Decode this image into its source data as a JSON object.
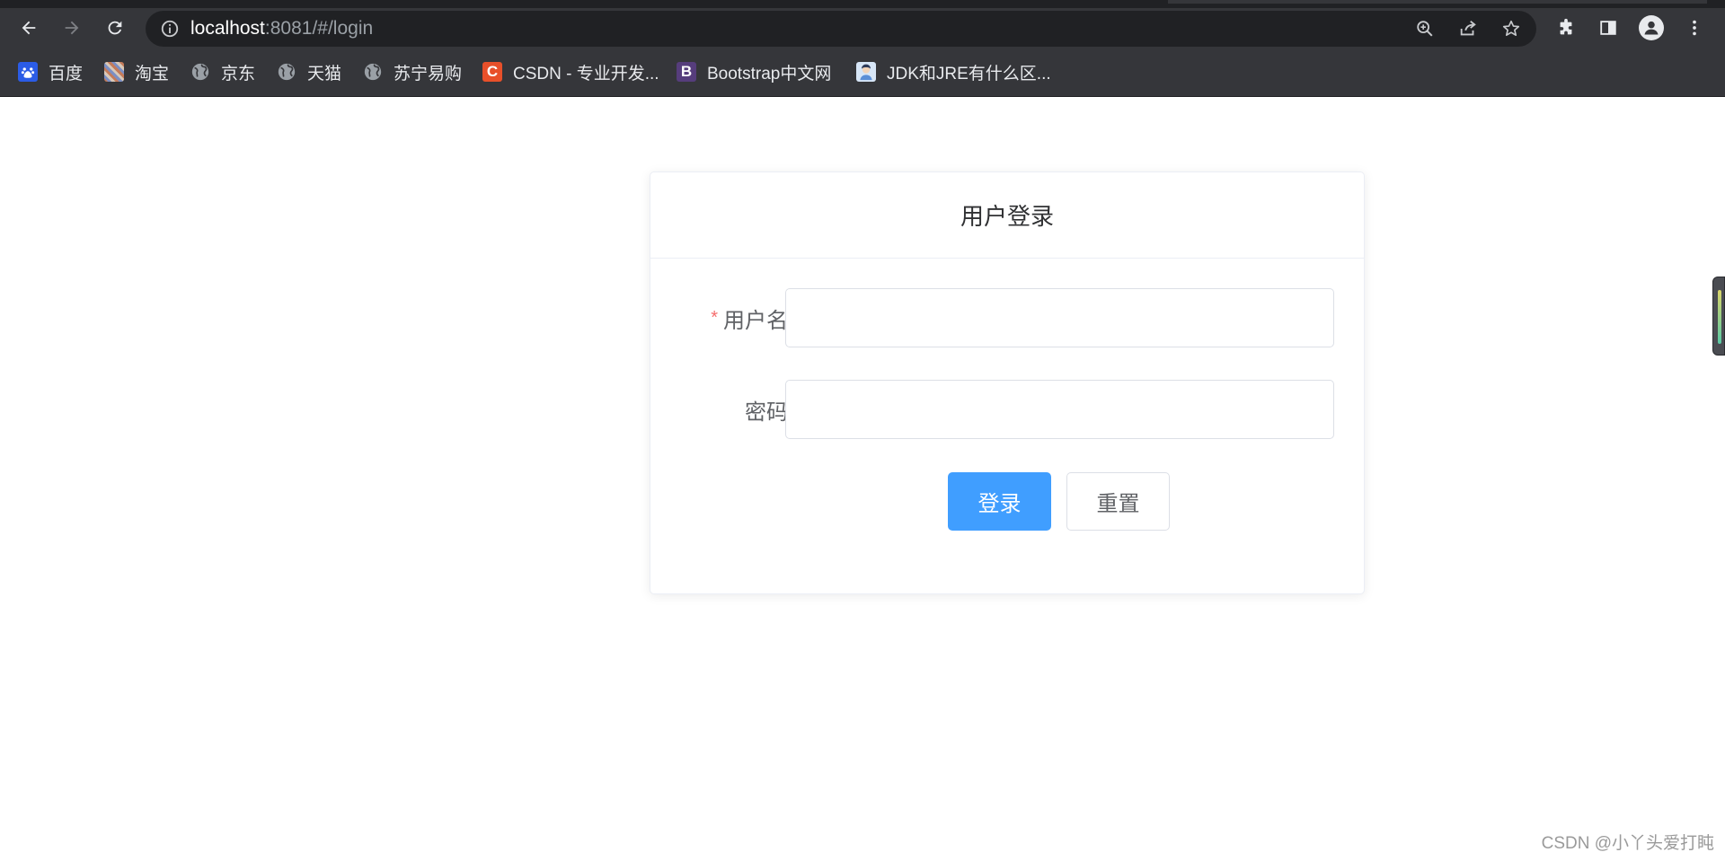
{
  "browser": {
    "url_host": "localhost",
    "url_rest": ":8081/#/login",
    "bookmarks": [
      {
        "label": "百度",
        "fav_color": "#2b5ce6",
        "fav_glyph": "🐾",
        "icon": "baidu-icon"
      },
      {
        "label": "淘宝",
        "fav_color": "#b48a6a",
        "fav_glyph": "",
        "icon": "taobao-icon"
      },
      {
        "label": "京东",
        "fav_color": "",
        "fav_glyph": "",
        "icon": "globe-icon"
      },
      {
        "label": "天猫",
        "fav_color": "",
        "fav_glyph": "",
        "icon": "globe-icon"
      },
      {
        "label": "苏宁易购",
        "fav_color": "",
        "fav_glyph": "",
        "icon": "globe-icon"
      },
      {
        "label": "CSDN - 专业开发...",
        "fav_color": "#e8502a",
        "fav_glyph": "C",
        "icon": "csdn-icon"
      },
      {
        "label": "Bootstrap中文网",
        "fav_color": "#563d7c",
        "fav_glyph": "B",
        "icon": "bootstrap-icon"
      },
      {
        "label": "JDK和JRE有什么区...",
        "fav_color": "#5b8fd6",
        "fav_glyph": "",
        "icon": "avatar-icon"
      }
    ]
  },
  "login": {
    "title": "用户登录",
    "username_label": "用户名",
    "required_mark": "*",
    "username_value": "",
    "password_label": "密码",
    "password_value": "",
    "login_button": "登录",
    "reset_button": "重置"
  },
  "colors": {
    "primary": "#409eff",
    "required": "#f56c6c",
    "border": "#dcdfe6"
  },
  "watermark": "CSDN @小丫头爱打盹"
}
